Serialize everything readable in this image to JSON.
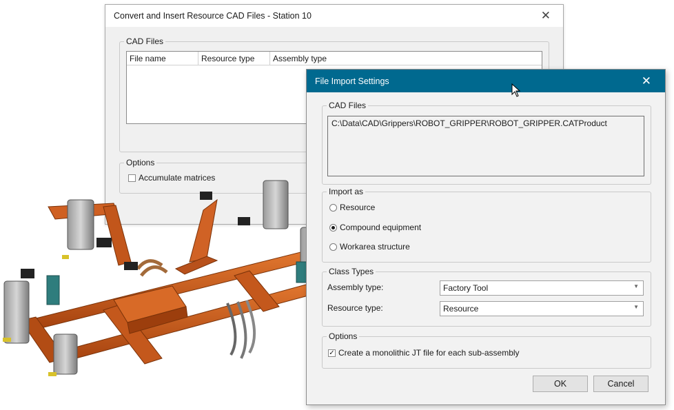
{
  "back_dialog": {
    "title": "Convert and Insert Resource CAD Files - Station 10",
    "cad_files_label": "CAD Files",
    "columns": [
      "File name",
      "Resource type",
      "Assembly type"
    ],
    "options_label": "Options",
    "accumulate_label": "Accumulate matrices",
    "accumulate_checked": false
  },
  "file_import_settings": {
    "title": "File Import Settings",
    "cad_files_label": "CAD Files",
    "file_path": "C:\\Data\\CAD\\Grippers\\ROBOT_GRIPPER\\ROBOT_GRIPPER.CATProduct",
    "import_as_label": "Import as",
    "import_options": [
      {
        "label": "Resource",
        "selected": false
      },
      {
        "label": "Compound equipment",
        "selected": true
      },
      {
        "label": "Workarea structure",
        "selected": false
      }
    ],
    "class_types_label": "Class Types",
    "assembly_type_label": "Assembly type:",
    "assembly_type_value": "Factory Tool",
    "resource_type_label": "Resource type:",
    "resource_type_value": "Resource",
    "options_label": "Options",
    "monolithic_label": "Create a monolithic JT file for each sub-assembly",
    "monolithic_checked": true,
    "ok_label": "OK",
    "cancel_label": "Cancel"
  },
  "glyphs": {
    "close": "✕",
    "dropdown": "▼",
    "check": "✓"
  },
  "colors": {
    "titlebar": "#00698f",
    "frame": "#c8501e"
  }
}
